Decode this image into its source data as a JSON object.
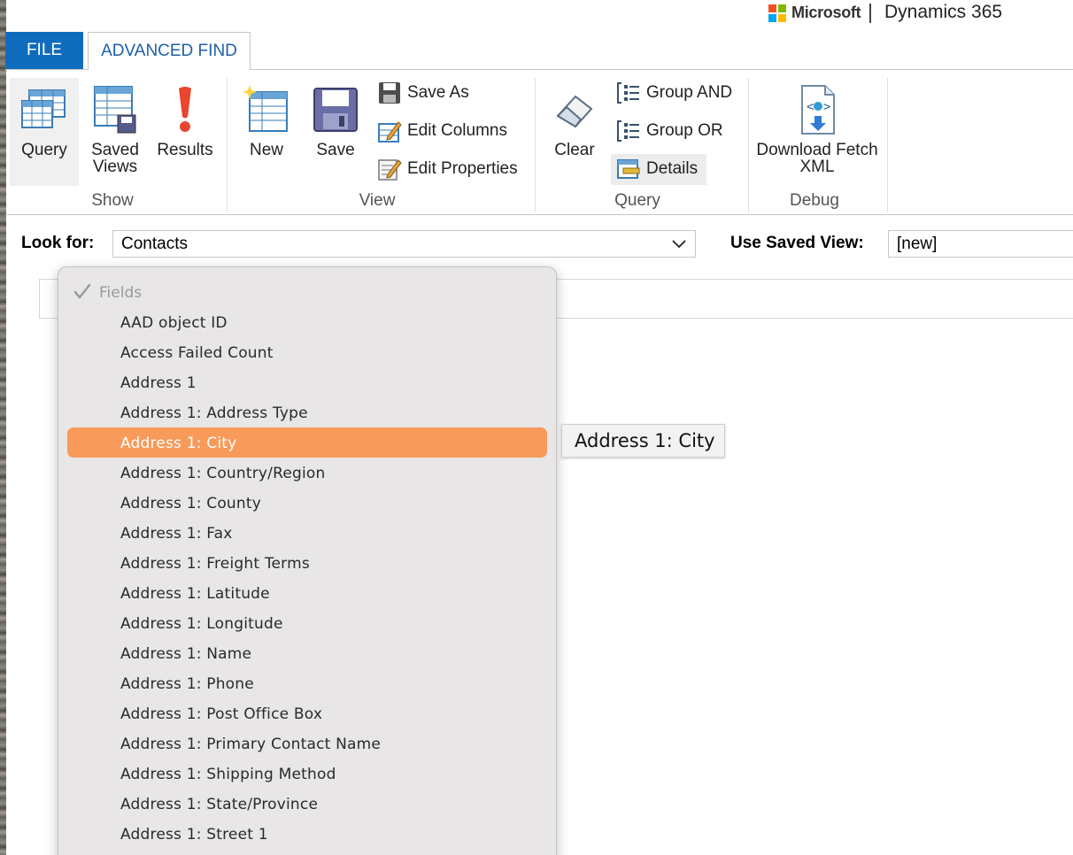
{
  "brand": {
    "company": "Microsoft",
    "product": "Dynamics 365"
  },
  "tabs": {
    "file": "FILE",
    "advanced_find": "ADVANCED FIND"
  },
  "ribbon": {
    "show": {
      "label": "Show",
      "query": "Query",
      "saved_views": "Saved Views",
      "results": "Results"
    },
    "view": {
      "label": "View",
      "new": "New",
      "save": "Save",
      "save_as": "Save As",
      "edit_columns": "Edit Columns",
      "edit_properties": "Edit Properties"
    },
    "query": {
      "label": "Query",
      "clear": "Clear",
      "group_and": "Group AND",
      "group_or": "Group OR",
      "details": "Details"
    },
    "debug": {
      "label": "Debug",
      "download_fetch_xml_line1": "Download Fetch",
      "download_fetch_xml_line2": "XML"
    }
  },
  "look_for": {
    "label": "Look for:",
    "value": "Contacts"
  },
  "use_saved_view": {
    "label": "Use Saved View:",
    "value": "[new]"
  },
  "dropdown": {
    "header": "Fields",
    "selected_index": 4,
    "items": [
      "AAD object ID",
      "Access Failed Count",
      "Address 1",
      "Address 1: Address Type",
      "Address 1: City",
      "Address 1: Country/Region",
      "Address 1: County",
      "Address 1: Fax",
      "Address 1: Freight Terms",
      "Address 1: Latitude",
      "Address 1: Longitude",
      "Address 1: Name",
      "Address 1: Phone",
      "Address 1: Post Office Box",
      "Address 1: Primary Contact Name",
      "Address 1: Shipping Method",
      "Address 1: State/Province",
      "Address 1: Street 1"
    ]
  },
  "tooltip": "Address 1: City",
  "colors": {
    "file_tab": "#0f6cbd",
    "selection": "#f79a5a",
    "tab_text": "#1e5fa8"
  },
  "icons": {
    "query": "query-grid-icon",
    "saved_views": "saved-views-icon",
    "results": "exclamation-icon",
    "new": "new-view-icon",
    "save": "floppy-disk-icon",
    "clear": "eraser-icon",
    "download": "download-xml-icon"
  }
}
